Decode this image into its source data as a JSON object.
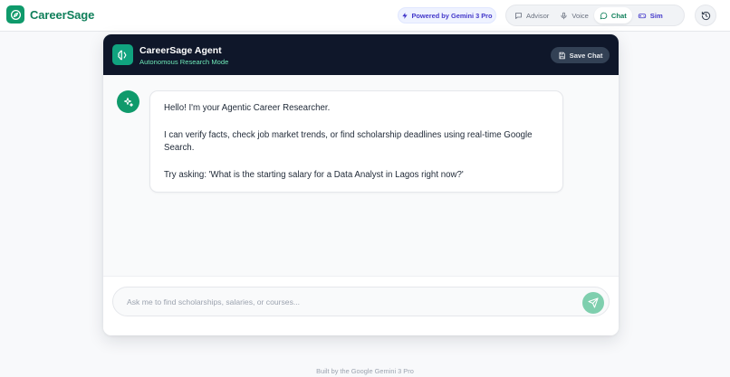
{
  "brand": {
    "name": "CareerSage",
    "logo_icon": "compass-icon",
    "color": "#0f9a6b"
  },
  "header": {
    "badge": {
      "label": "Powered by Gemini 3 Pro",
      "icon": "lightning-icon"
    },
    "modes": [
      {
        "label": "Advisor",
        "icon": "message-square-icon",
        "active": false
      },
      {
        "label": "Voice",
        "icon": "microphone-icon",
        "active": false
      },
      {
        "label": "Chat",
        "icon": "message-circle-icon",
        "active": true
      },
      {
        "label": "Sim",
        "icon": "gamepad-icon",
        "active": false
      }
    ],
    "history_icon": "history-icon"
  },
  "chat": {
    "title": "CareerSage Agent",
    "subtitle": "Autonomous Research Mode",
    "save_label": "Save Chat",
    "messages": [
      {
        "role": "agent",
        "lines": [
          "Hello! I'm your Agentic Career Researcher.",
          "I can verify facts, check job market trends, or find scholarship deadlines using real-time Google Search.",
          "Try asking: 'What is the starting salary for a Data Analyst in Lagos right now?'"
        ]
      }
    ],
    "input": {
      "placeholder": "Ask me to find scholarships, salaries, or courses...",
      "value": ""
    }
  },
  "footer": {
    "text": "Built by the Google Gemini 3 Pro"
  },
  "colors": {
    "header_dark": "#0f172a",
    "accent_green": "#10a37f",
    "badge_indigo": "#4338ca"
  }
}
